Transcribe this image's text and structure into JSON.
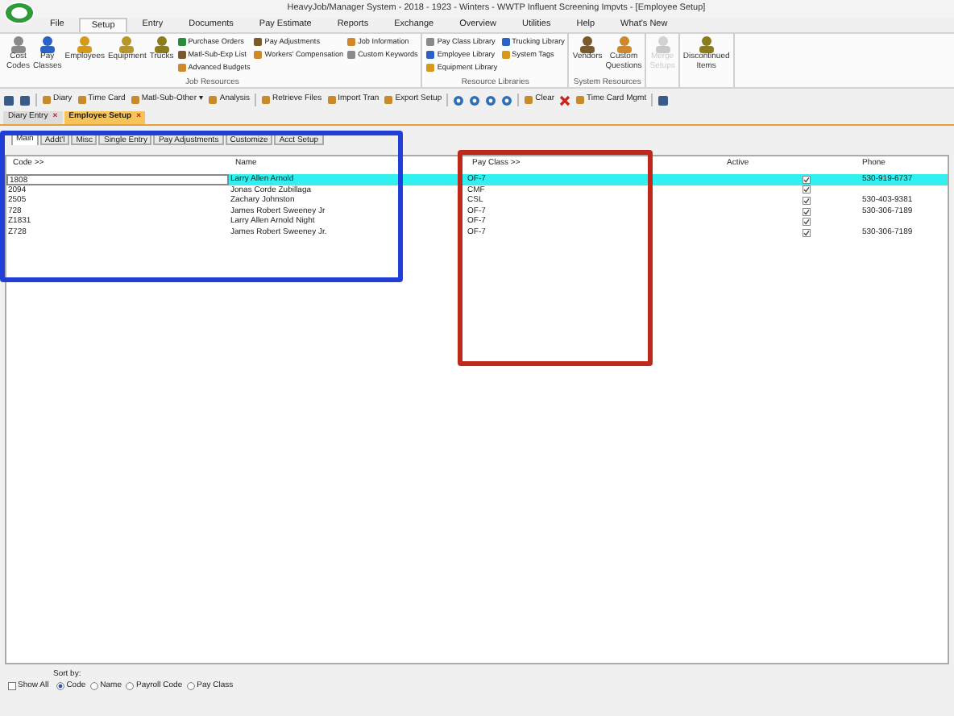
{
  "window": {
    "title": "HeavyJob/Manager System - 2018 - 1923 - Winters - WWTP Influent Screening Impvts - [Employee Setup]"
  },
  "menu_tabs": [
    {
      "label": "File",
      "selected": false
    },
    {
      "label": "Setup",
      "selected": true
    },
    {
      "label": "Entry",
      "selected": false
    },
    {
      "label": "Documents",
      "selected": false
    },
    {
      "label": "Pay Estimate",
      "selected": false
    },
    {
      "label": "Reports",
      "selected": false
    },
    {
      "label": "Exchange",
      "selected": false
    },
    {
      "label": "Overview",
      "selected": false
    },
    {
      "label": "Utilities",
      "selected": false
    },
    {
      "label": "Help",
      "selected": false
    },
    {
      "label": "What's New",
      "selected": false
    }
  ],
  "ribbon_groups": [
    {
      "title": "Job Resources",
      "items": [
        {
          "kind": "large",
          "label": "Cost Codes",
          "disabled": false
        },
        {
          "kind": "large",
          "label": "Pay Classes",
          "disabled": false
        },
        {
          "kind": "large",
          "label": "Employees",
          "disabled": false
        },
        {
          "kind": "large",
          "label": "Equipment",
          "disabled": false
        },
        {
          "kind": "large",
          "label": "Trucks",
          "disabled": false
        },
        {
          "kind": "stack",
          "entries": [
            "Purchase Orders",
            "Matl-Sub-Exp List",
            "Advanced Budgets"
          ]
        },
        {
          "kind": "stack",
          "entries": [
            "Pay Adjustments",
            "Workers' Compensation"
          ]
        },
        {
          "kind": "stack",
          "entries": [
            "Job Information",
            "Custom Keywords"
          ]
        }
      ]
    },
    {
      "title": "Resource Libraries",
      "items": [
        {
          "kind": "stack",
          "entries": [
            "Pay Class Library",
            "Employee Library",
            "Equipment Library"
          ]
        },
        {
          "kind": "stack",
          "entries": [
            "Trucking Library",
            "System Tags"
          ]
        }
      ]
    },
    {
      "title": "System Resources",
      "items": [
        {
          "kind": "large",
          "label": "Vendors",
          "disabled": false
        },
        {
          "kind": "large",
          "label": "Custom Questions",
          "disabled": false
        }
      ]
    },
    {
      "items": [
        {
          "kind": "large",
          "label": "Merge Setups",
          "disabled": true
        }
      ]
    },
    {
      "items": [
        {
          "kind": "large",
          "label": "Discontinued Items",
          "disabled": false
        }
      ]
    }
  ],
  "toolbar": [
    {
      "kind": "icon"
    },
    {
      "kind": "icon"
    },
    {
      "kind": "separator"
    },
    {
      "kind": "labeled",
      "label": "Diary"
    },
    {
      "kind": "labeled",
      "label": "Time Card"
    },
    {
      "kind": "labeled",
      "label": "Matl-Sub-Other ▾"
    },
    {
      "kind": "labeled",
      "label": "Analysis"
    },
    {
      "kind": "separator"
    },
    {
      "kind": "labeled",
      "label": "Retrieve Files"
    },
    {
      "kind": "labeled",
      "label": "Import Tran"
    },
    {
      "kind": "labeled",
      "label": "Export Setup"
    },
    {
      "kind": "separator"
    },
    {
      "kind": "nav"
    },
    {
      "kind": "nav"
    },
    {
      "kind": "nav"
    },
    {
      "kind": "nav"
    },
    {
      "kind": "separator"
    },
    {
      "kind": "labeled",
      "label": "Clear"
    },
    {
      "kind": "delete"
    },
    {
      "kind": "labeled",
      "label": "Time Card Mgmt"
    },
    {
      "kind": "separator"
    },
    {
      "kind": "icon"
    }
  ],
  "doc_tabs": [
    {
      "label": "Diary Entry",
      "close": "×",
      "selected": false
    },
    {
      "label": "Employee Setup",
      "close": "×",
      "selected": true
    }
  ],
  "inner_tabs": [
    {
      "label": "Main",
      "selected": true
    },
    {
      "label": "Addt'l",
      "selected": false
    },
    {
      "label": "Misc",
      "selected": false
    },
    {
      "label": "Single Entry",
      "selected": false
    },
    {
      "label": "Pay Adjustments",
      "selected": false
    },
    {
      "label": "Customize",
      "selected": false
    },
    {
      "label": "Acct Setup",
      "selected": false
    }
  ],
  "table": {
    "columns": [
      "Code >>",
      "Name",
      "Pay Class >>",
      "Active",
      "Phone"
    ],
    "rows": [
      {
        "code": "1808",
        "name": "Larry Allen Arnold",
        "pay_class": "OF-7",
        "active": true,
        "phone": "530-919-6737",
        "selected": true
      },
      {
        "code": "2094",
        "name": "Jonas Corde Zubillaga",
        "pay_class": "CMF",
        "active": true,
        "selected": false
      },
      {
        "code": "2505",
        "name": "Zachary Johnston",
        "pay_class": "CSL",
        "active": true,
        "phone": "530-403-9381",
        "selected": false
      },
      {
        "code": "728",
        "name": "James Robert Sweeney Jr",
        "pay_class": "OF-7",
        "active": true,
        "phone": "530-306-7189",
        "selected": false
      },
      {
        "code": "Z1831",
        "name": "Larry Allen Arnold Night",
        "pay_class": "OF-7",
        "active": true,
        "selected": false
      },
      {
        "code": "Z728",
        "name": "James Robert Sweeney Jr.",
        "pay_class": "OF-7",
        "active": true,
        "phone": "530-306-7189",
        "selected": false
      }
    ]
  },
  "footer": {
    "show_all": {
      "label": "Show All",
      "checked": false
    },
    "sort_label": "Sort by:",
    "sort_options": [
      {
        "label": "Code",
        "selected": true
      },
      {
        "label": "Name",
        "selected": false
      },
      {
        "label": "Payroll Code",
        "selected": false
      },
      {
        "label": "Pay Class",
        "selected": false
      }
    ]
  },
  "annotations": [
    {
      "color": "#1f3fd6"
    },
    {
      "color": "#c0281c"
    }
  ]
}
